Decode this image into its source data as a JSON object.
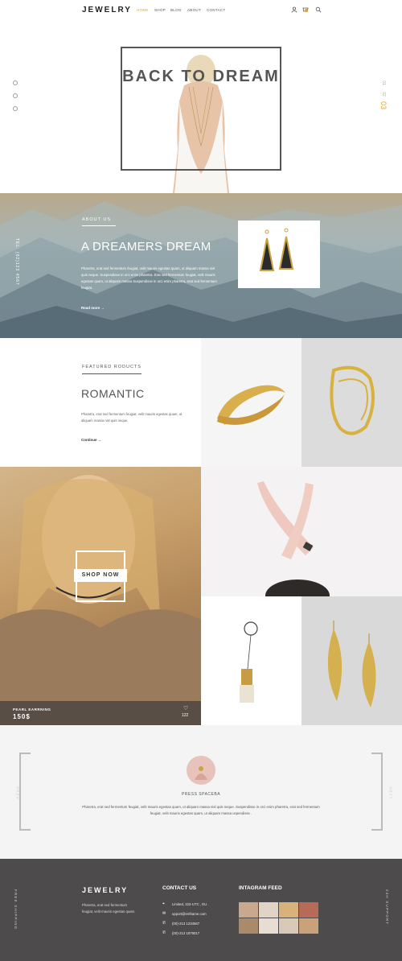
{
  "header": {
    "logo": "JEWELRY",
    "nav": [
      "HOME",
      "SHOP",
      "BLOG",
      "ABOUT",
      "CONTACT"
    ],
    "active_index": 0,
    "icons": [
      "user-icon",
      "cart-icon",
      "search-icon"
    ]
  },
  "hero": {
    "title": "BACK TO DREAM",
    "slide_total": "02",
    "slide_prev": "01",
    "slide_current": "03",
    "social_icons": [
      "facebook-icon",
      "twitter-icon",
      "pinterest-icon"
    ]
  },
  "about": {
    "label": "ABOUT US",
    "title": "A DREAMERS DREAM",
    "text": "Pharetra, erat sed fermentum feugiat, velit mauris egestas quam, ut aliquam massa nisl quis neque. Suspendisse in orci enim pharetra. Erat sed fermentum feugiat, velit mauris egestas quam, ut aliquam massa Suspendisse in orci enim pharetra, erat sed fermentum feugiat.",
    "read_more": "Read more",
    "tel": "TEL: (02)123 4567"
  },
  "featured": {
    "label": "FEATURED RODUCTS",
    "title": "ROMANTIC",
    "text": "Pharetra, erat sed fermentum feugiat, velit mauris egestas quam, ut aliquam massa nisl quis neque.",
    "continue": "Continue"
  },
  "promo": {
    "shop_now": "SHOP NOW",
    "product_name": "PEARL EARRNING",
    "price": "150$",
    "likes": "122"
  },
  "testimonial": {
    "name": "PRESS SPACEBA",
    "text": "Pharetra, erat sed fermentum feugiat, velit mauris egestas quam, ut aliquam massa nisl quis neque. Suspendisse in orci enim pharetra, erat sed fermentum feugiat, velit mauris egestas quam, ut aliquam massa uspendisse .",
    "prev": "PREV",
    "next": "NEXT"
  },
  "footer": {
    "logo": "JEWELRY",
    "text": "Pharetra, erat sed fermentum feugiat, velit mauris egestas quam.",
    "contact_title": "CONTACT US",
    "contact": [
      {
        "icon": "location-icon",
        "text": "Limited, 222-UTC , EU ."
      },
      {
        "icon": "mail-icon",
        "text": "upport@enthame.com"
      },
      {
        "icon": "phone-icon",
        "text": "(00)-213 1234567"
      },
      {
        "icon": "phone-icon",
        "text": "(00)-213 1879017"
      }
    ],
    "instagram_title": "INTAGRAM FEED",
    "side_left": "FREE SHIPPING",
    "side_right": "24H SUPPORT"
  },
  "colors": {
    "accent": "#e0a42c",
    "dark": "#4d4b4c"
  }
}
